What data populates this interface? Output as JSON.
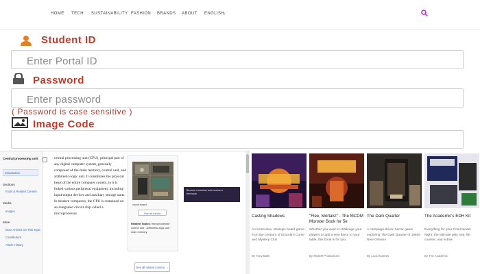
{
  "nav": {
    "items": [
      "HOME",
      "TECH",
      "SUSTAINABILITY",
      "FASHION",
      "BRANDS",
      "ABOUT",
      "ENGLISH"
    ],
    "accent": "#c026d3"
  },
  "form": {
    "student_label": "Student ID",
    "student_placeholder": "Enter Portal ID",
    "password_label": "Password",
    "password_placeholder": "Enter password",
    "password_note": "( Password is case sensitive )",
    "image_label": "Image Code",
    "label_color": "#c0392b"
  },
  "wiki": {
    "toc_title": "Central processing unit",
    "toc_selected": "Introduction",
    "toc_groups": [
      {
        "heading": "Sections",
        "items": [
          "Facts & Related Content"
        ]
      },
      {
        "heading": "Media",
        "items": [
          "Images"
        ]
      },
      {
        "heading": "More",
        "items": [
          "More Articles On This Topic",
          "Contributors",
          "Article History"
        ]
      }
    ],
    "article_text": "central processing unit (CPU), principal part of any digital computer system, generally composed of the main memory, control unit, and arithmetic-logic unit. It constitutes the physical heart of the entire computer system; to it is linked various peripheral equipment, including input/output devices and auxiliary storage units. In modern computers, the CPU is contained on an integrated circuit chip called a microprocessor.",
    "infobox_caption": "circuit board",
    "see_media": "See all media",
    "related_title": "Related Topics:",
    "related_text": "microprocessor · control unit · arithmetic-logic unit · main memory",
    "see_all": "See all related content →",
    "ad_text": "Become a member and receive a free book"
  },
  "cards": [
    {
      "title": "Casting Shadows",
      "desc": "An immersive, strategic board game from the creators of Dracula's Curse and Mystery Club",
      "by": "By Tony Baile"
    },
    {
      "title": "\"Flee, Mortals!\" - The MCDM Monster Book for 5e",
      "desc": "Whether you want to challenge your players or add a new flavor to your table, this book is for you.",
      "by": "By MCDM Productions"
    },
    {
      "title": "The Dark Quarter",
      "desc": "A campaign-driven horror game exploring The Dark Quarter of 1980s New Orleans",
      "by": "By Lucid Games"
    },
    {
      "title": "The Academic's EDH Kit",
      "desc": "Everything for your Commander Night: the ultimate play mat, life counter, and extras",
      "by": "By The Academic"
    }
  ]
}
